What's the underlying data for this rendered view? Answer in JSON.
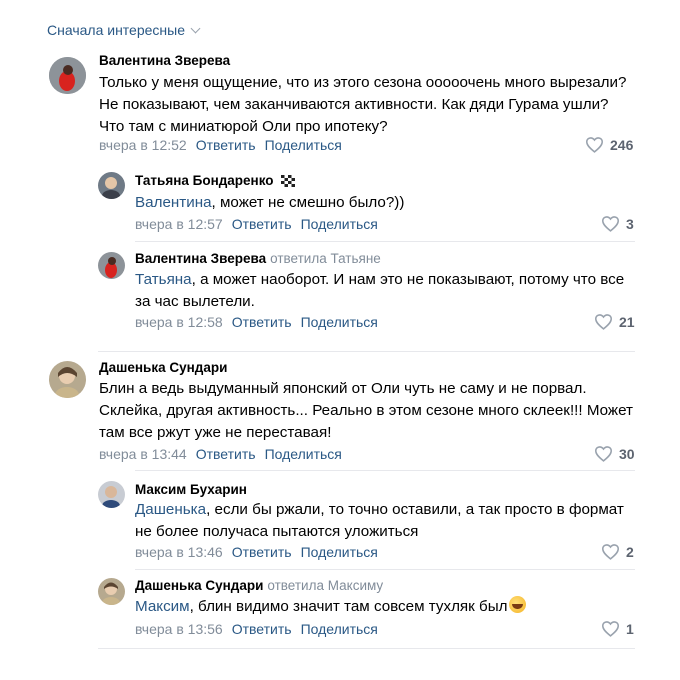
{
  "sort": {
    "label": "Сначала интересные"
  },
  "comments": [
    {
      "author": "Валентина Зверева",
      "replied": "",
      "lines": [
        "Только у меня ощущение, что из этого сезона ооооочень много вырезали?",
        "Не показывают, чем заканчиваются активности. Как дяди Гурама ушли?",
        "Что там с миниатюрой Оли про ипотеку?"
      ],
      "time": "вчера в 12:52",
      "reply": "Ответить",
      "share": "Поделиться",
      "likes": "246"
    },
    {
      "author": "Татьяна Бондаренко",
      "replied": "",
      "mention": "Валентина",
      "lines": [
        ", может не смешно было?))"
      ],
      "time": "вчера в 12:57",
      "reply": "Ответить",
      "share": "Поделиться",
      "likes": "3"
    },
    {
      "author": "Валентина Зверева",
      "replied": "ответила Татьяне",
      "mention": "Татьяна",
      "lines": [
        ", а может наоборот. И нам это не показывают, потому что все",
        "за час вылетели."
      ],
      "time": "вчера в 12:58",
      "reply": "Ответить",
      "share": "Поделиться",
      "likes": "21"
    },
    {
      "author": "Дашенька Сундари",
      "replied": "",
      "lines": [
        "Блин а ведь выдуманный японский от Оли чуть не саму и не порвал.",
        "Склейка, другая активность... Реально в этом сезоне много склеек!!! Может",
        "там все ржут уже не переставая!"
      ],
      "time": "вчера в 13:44",
      "reply": "Ответить",
      "share": "Поделиться",
      "likes": "30"
    },
    {
      "author": "Максим Бухарин",
      "replied": "",
      "mention": "Дашенька",
      "lines": [
        ", если бы ржали, то точно оставили, а так просто в формат",
        "не более получаса пытаются уложиться"
      ],
      "time": "вчера в 13:46",
      "reply": "Ответить",
      "share": "Поделиться",
      "likes": "2"
    },
    {
      "author": "Дашенька Сундари",
      "replied": "ответила Максиму",
      "mention": "Максим",
      "lines": [
        ", блин видимо значит там совсем тухляк был"
      ],
      "time": "вчера в 13:56",
      "reply": "Ответить",
      "share": "Поделиться",
      "likes": "1"
    }
  ],
  "icons": {
    "heart": "heart-outline-icon",
    "sort_chevron": "chevron-down-icon",
    "checker_flag": "checkered-flag-icon",
    "emoji": "rofl-emoji"
  },
  "colors": {
    "link": "#2a5885",
    "meta": "#818c99",
    "separator": "#e7e8ec",
    "like": "#5d6470"
  }
}
